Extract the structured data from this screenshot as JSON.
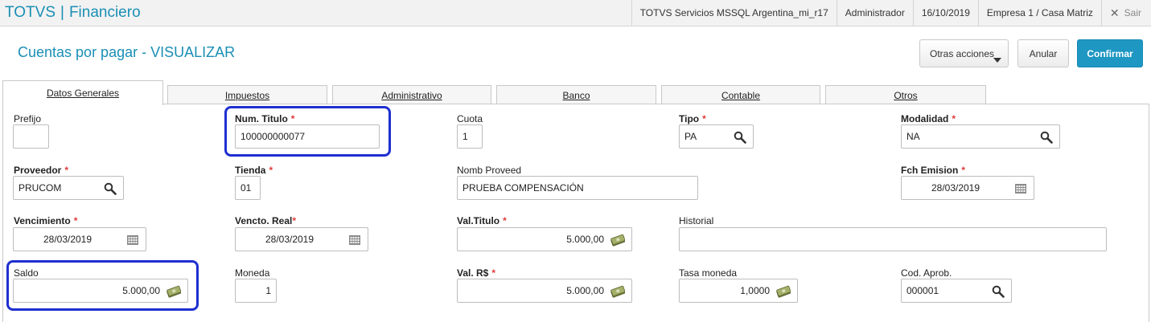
{
  "header": {
    "app_name": "TOTVS",
    "separator": "|",
    "module": "Financiero",
    "environment": "TOTVS Servicios MSSQL Argentina_mi_r17",
    "user": "Administrador",
    "date": "16/10/2019",
    "company": "Empresa 1 / Casa Matriz",
    "exit_label": "Sair"
  },
  "page": {
    "title": "Cuentas por pagar - VISUALIZAR"
  },
  "actions": {
    "more_label": "Otras acciones",
    "cancel_label": "Anular",
    "confirm_label": "Confirmar"
  },
  "tabs": [
    {
      "label": "Datos Generales",
      "active": true
    },
    {
      "label": "Impuestos"
    },
    {
      "label": "Administrativo"
    },
    {
      "label": "Banco"
    },
    {
      "label": "Contable"
    },
    {
      "label": "Otros"
    }
  ],
  "required_marker": "*",
  "fields": {
    "prefijo": {
      "label": "Prefijo",
      "value": ""
    },
    "num_titulo": {
      "label": "Num. Titulo",
      "value": "100000000077"
    },
    "cuota": {
      "label": "Cuota",
      "value": "1"
    },
    "tipo": {
      "label": "Tipo",
      "value": "PA"
    },
    "modalidad": {
      "label": "Modalidad",
      "value": "NA"
    },
    "proveedor": {
      "label": "Proveedor",
      "value": "PRUCOM"
    },
    "tienda": {
      "label": "Tienda",
      "value": "01"
    },
    "nomb_proveed": {
      "label": "Nomb Proveed",
      "value": "PRUEBA COMPENSACIÓN"
    },
    "fch_emision": {
      "label": "Fch Emision",
      "value": "28/03/2019"
    },
    "vencimiento": {
      "label": "Vencimiento",
      "value": "28/03/2019"
    },
    "vencto_real": {
      "label": "Vencto. Real",
      "value": "28/03/2019"
    },
    "val_titulo": {
      "label": "Val.Titulo",
      "value": "5.000,00"
    },
    "historial": {
      "label": "Historial",
      "value": ""
    },
    "saldo": {
      "label": "Saldo",
      "value": "5.000,00"
    },
    "moneda": {
      "label": "Moneda",
      "value": "1"
    },
    "val_rs": {
      "label": "Val. R$",
      "value": "5.000,00"
    },
    "tasa_moneda": {
      "label": "Tasa moneda",
      "value": "1,0000"
    },
    "cod_aprob": {
      "label": "Cod. Aprob.",
      "value": "000001"
    }
  },
  "icons": {
    "search": "magnifier-icon",
    "calendar": "calendar-grid-icon",
    "money": "banknote-icon",
    "close": "close-x-icon"
  },
  "colors": {
    "brand": "#1a8fb5",
    "confirm_button": "#1e97c3",
    "required": "#e23a3a",
    "highlight_box": "#1f2fd0"
  }
}
